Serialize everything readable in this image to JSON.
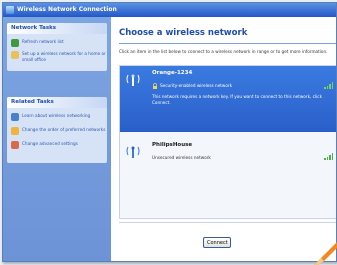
{
  "window": {
    "title": "Wireless Network Connection"
  },
  "sidebar": {
    "network_tasks": {
      "header": "Network Tasks",
      "items": [
        {
          "label": "Refresh network list",
          "icon": "refresh-icon"
        },
        {
          "label": "Set up a wireless network for a home or small office",
          "icon": "setup-wireless-icon"
        }
      ]
    },
    "related_tasks": {
      "header": "Related Tasks",
      "items": [
        {
          "label": "Learn about wireless networking",
          "icon": "learn-icon"
        },
        {
          "label": "Change the order of preferred networks",
          "icon": "star-icon"
        },
        {
          "label": "Change advanced settings",
          "icon": "settings-icon"
        }
      ]
    }
  },
  "main": {
    "title": "Choose a wireless network",
    "instructions": "Click an item in the list below to connect to a wireless network in range or to get more information.",
    "networks": [
      {
        "name": "Orange-1234",
        "status": "Security-enabled wireless network",
        "description": "This network requires a network key. If you want to connect to this network, click Connect.",
        "selected": true
      },
      {
        "name": "PhilipsHouse",
        "status": "Unsecured wireless network",
        "selected": false
      }
    ],
    "connect_label": "Connect"
  },
  "colors": {
    "title_bar": "#2457c7",
    "sidebar": "#6b93d6",
    "task_panel": "#d6e3f7",
    "selected_network": "#2a5fc9",
    "heading": "#1f4fa8",
    "signal": "#7bd35a"
  }
}
